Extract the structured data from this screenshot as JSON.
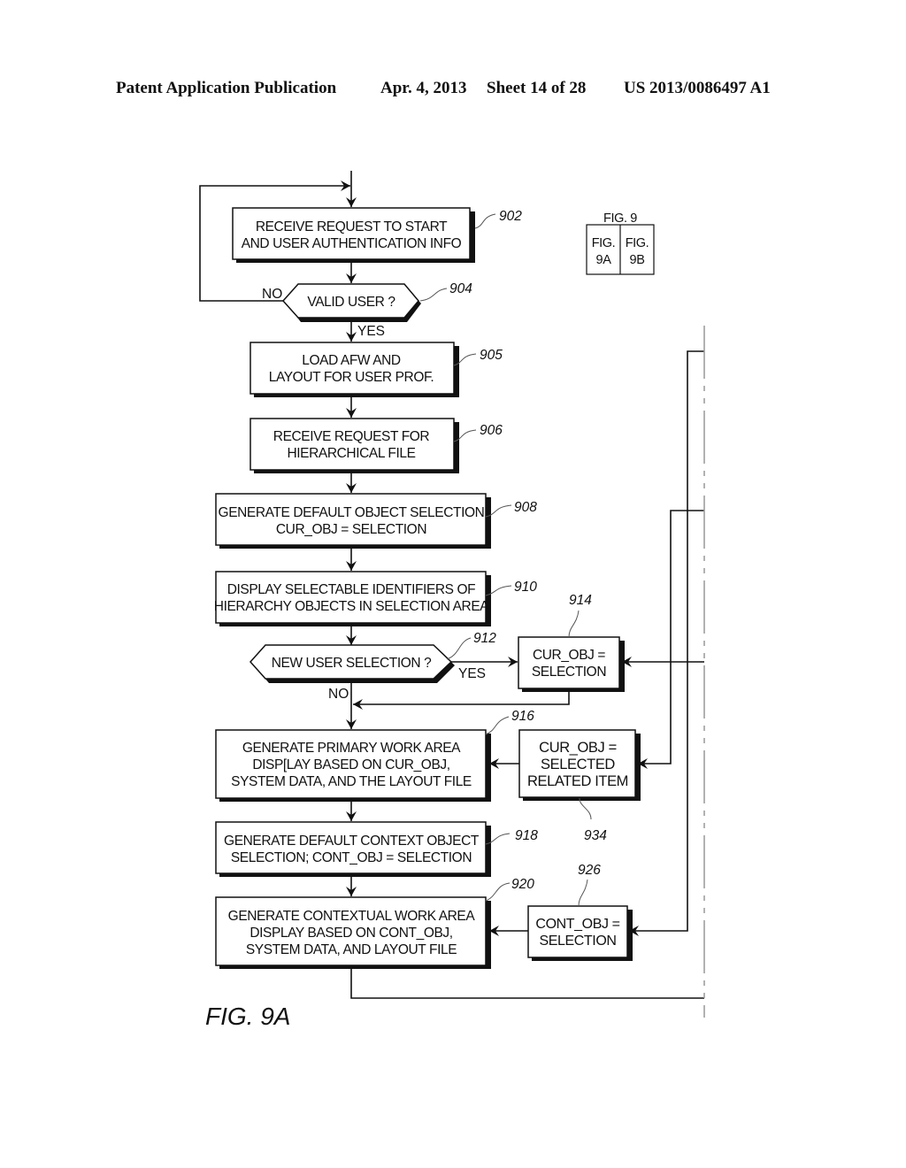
{
  "header": {
    "publication": "Patent Application Publication",
    "date": "Apr. 4, 2013",
    "sheet": "Sheet 14 of 28",
    "number": "US 2013/0086497 A1"
  },
  "figure_key": {
    "title": "FIG. 9",
    "left_line1": "FIG.",
    "left_line2": "9A",
    "right_line1": "FIG.",
    "right_line2": "9B"
  },
  "steps": {
    "s902": {
      "ref": "902",
      "lines": [
        "RECEIVE REQUEST TO START",
        "AND USER AUTHENTICATION INFO"
      ]
    },
    "s904": {
      "ref": "904",
      "lines": [
        "VALID USER ?"
      ]
    },
    "s905": {
      "ref": "905",
      "lines": [
        "LOAD AFW AND",
        "LAYOUT FOR USER PROF."
      ]
    },
    "s906": {
      "ref": "906",
      "lines": [
        "RECEIVE REQUEST FOR",
        "HIERARCHICAL FILE"
      ]
    },
    "s908": {
      "ref": "908",
      "lines": [
        "GENERATE DEFAULT OBJECT SELECTION",
        "CUR_OBJ = SELECTION"
      ]
    },
    "s910": {
      "ref": "910",
      "lines": [
        "DISPLAY SELECTABLE IDENTIFIERS OF",
        "HIERARCHY OBJECTS IN SELECTION AREA"
      ]
    },
    "s912": {
      "ref": "912",
      "lines": [
        "NEW USER SELECTION  ?"
      ]
    },
    "s914": {
      "ref": "914",
      "lines": [
        "CUR_OBJ =",
        "SELECTION"
      ]
    },
    "s916": {
      "ref": "916",
      "lines": [
        "GENERATE PRIMARY WORK AREA",
        "DISP[LAY BASED ON CUR_OBJ,",
        "SYSTEM DATA, AND THE LAYOUT FILE"
      ]
    },
    "s934": {
      "ref": "934",
      "lines": [
        "CUR_OBJ =",
        "SELECTED",
        "RELATED ITEM"
      ]
    },
    "s918": {
      "ref": "918",
      "lines": [
        "GENERATE DEFAULT CONTEXT OBJECT",
        "SELECTION;  CONT_OBJ = SELECTION"
      ]
    },
    "s920": {
      "ref": "920",
      "lines": [
        "GENERATE CONTEXTUAL WORK AREA",
        "DISPLAY BASED ON CONT_OBJ,",
        "SYSTEM DATA, AND LAYOUT FILE"
      ]
    },
    "s926": {
      "ref": "926",
      "lines": [
        "CONT_OBJ =",
        "SELECTION"
      ]
    }
  },
  "branch_labels": {
    "no_904": "NO",
    "yes_904": "YES",
    "yes_912": "YES",
    "no_912": "NO"
  },
  "figure_label": "FIG. 9A"
}
